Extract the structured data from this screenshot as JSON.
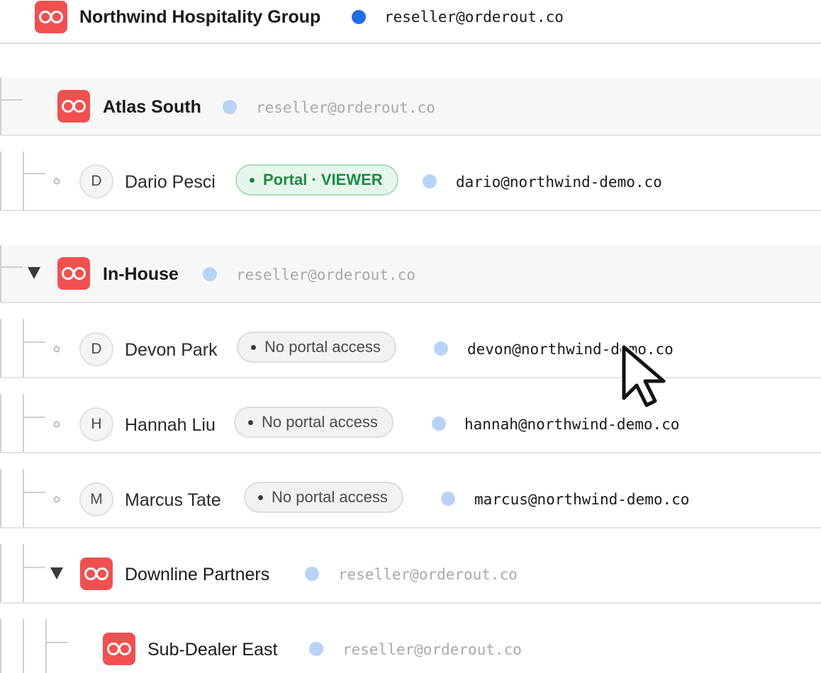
{
  "top_org": {
    "name": "Northwind Hospitality Group",
    "email": "reseller@orderout.co"
  },
  "groups": {
    "atlas": {
      "name": "Atlas South",
      "email": "reseller@orderout.co"
    },
    "inhouse": {
      "name": "In-House",
      "email": "reseller@orderout.co"
    },
    "downline": {
      "name": "Downline Partners",
      "email": "reseller@orderout.co"
    },
    "subdealer": {
      "name": "Sub-Dealer East",
      "email": "reseller@orderout.co"
    }
  },
  "users": {
    "dario": {
      "initial": "D",
      "name": "Dario Pesci",
      "badge": "Portal · VIEWER",
      "email": "dario@northwind-demo.co"
    },
    "devon": {
      "initial": "D",
      "name": "Devon Park",
      "badge": "No portal access",
      "email": "devon@northwind-demo.co"
    },
    "hannah": {
      "initial": "H",
      "name": "Hannah Liu",
      "badge": "No portal access",
      "email": "hannah@northwind-demo.co"
    },
    "marcus": {
      "initial": "M",
      "name": "Marcus Tate",
      "badge": "No portal access",
      "email": "marcus@northwind-demo.co"
    }
  },
  "colors": {
    "logo": "#f05050",
    "status_online": "#1f6fe0",
    "status_soft": "#b9d2f7",
    "viewer_badge": "#1c8a45"
  },
  "icons": {
    "logo": "oo-logo-icon",
    "expand": "caret-down-icon",
    "status": "status-dot-icon",
    "cursor": "mouse-pointer-icon"
  }
}
